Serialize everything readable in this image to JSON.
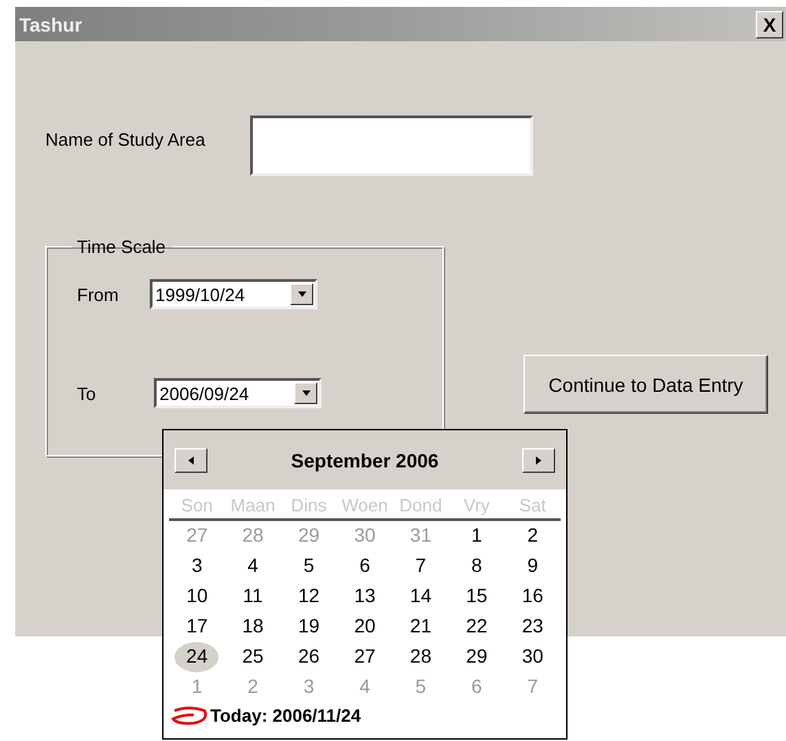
{
  "window": {
    "title": "Tashur",
    "close": "X"
  },
  "study_area": {
    "label": "Name of Study Area"
  },
  "time_scale": {
    "title": "Time Scale",
    "from": {
      "label": "From",
      "value": "1999/10/24"
    },
    "to": {
      "label": "To",
      "value": "2006/09/24"
    }
  },
  "continue_button": "Continue to Data Entry",
  "calendar": {
    "month": "September 2006",
    "weekdays": [
      "Son",
      "Maan",
      "Dins",
      "Woen",
      "Dond",
      "Vry",
      "Sat"
    ],
    "weeks": [
      [
        {
          "day": "27",
          "other_month": true,
          "selected": false
        },
        {
          "day": "28",
          "other_month": true,
          "selected": false
        },
        {
          "day": "29",
          "other_month": true,
          "selected": false
        },
        {
          "day": "30",
          "other_month": true,
          "selected": false
        },
        {
          "day": "31",
          "other_month": true,
          "selected": false
        },
        {
          "day": "1",
          "other_month": false,
          "selected": false
        },
        {
          "day": "2",
          "other_month": false,
          "selected": false
        }
      ],
      [
        {
          "day": "3",
          "other_month": false,
          "selected": false
        },
        {
          "day": "4",
          "other_month": false,
          "selected": false
        },
        {
          "day": "5",
          "other_month": false,
          "selected": false
        },
        {
          "day": "6",
          "other_month": false,
          "selected": false
        },
        {
          "day": "7",
          "other_month": false,
          "selected": false
        },
        {
          "day": "8",
          "other_month": false,
          "selected": false
        },
        {
          "day": "9",
          "other_month": false,
          "selected": false
        }
      ],
      [
        {
          "day": "10",
          "other_month": false,
          "selected": false
        },
        {
          "day": "11",
          "other_month": false,
          "selected": false
        },
        {
          "day": "12",
          "other_month": false,
          "selected": false
        },
        {
          "day": "13",
          "other_month": false,
          "selected": false
        },
        {
          "day": "14",
          "other_month": false,
          "selected": false
        },
        {
          "day": "15",
          "other_month": false,
          "selected": false
        },
        {
          "day": "16",
          "other_month": false,
          "selected": false
        }
      ],
      [
        {
          "day": "17",
          "other_month": false,
          "selected": false
        },
        {
          "day": "18",
          "other_month": false,
          "selected": false
        },
        {
          "day": "19",
          "other_month": false,
          "selected": false
        },
        {
          "day": "20",
          "other_month": false,
          "selected": false
        },
        {
          "day": "21",
          "other_month": false,
          "selected": false
        },
        {
          "day": "22",
          "other_month": false,
          "selected": false
        },
        {
          "day": "23",
          "other_month": false,
          "selected": false
        }
      ],
      [
        {
          "day": "24",
          "other_month": false,
          "selected": true
        },
        {
          "day": "25",
          "other_month": false,
          "selected": false
        },
        {
          "day": "26",
          "other_month": false,
          "selected": false
        },
        {
          "day": "27",
          "other_month": false,
          "selected": false
        },
        {
          "day": "28",
          "other_month": false,
          "selected": false
        },
        {
          "day": "29",
          "other_month": false,
          "selected": false
        },
        {
          "day": "30",
          "other_month": false,
          "selected": false
        }
      ],
      [
        {
          "day": "1",
          "other_month": true,
          "selected": false
        },
        {
          "day": "2",
          "other_month": true,
          "selected": false
        },
        {
          "day": "3",
          "other_month": true,
          "selected": false
        },
        {
          "day": "4",
          "other_month": true,
          "selected": false
        },
        {
          "day": "5",
          "other_month": true,
          "selected": false
        },
        {
          "day": "6",
          "other_month": true,
          "selected": false
        },
        {
          "day": "7",
          "other_month": true,
          "selected": false
        }
      ]
    ],
    "today": "Today: 2006/11/24"
  }
}
